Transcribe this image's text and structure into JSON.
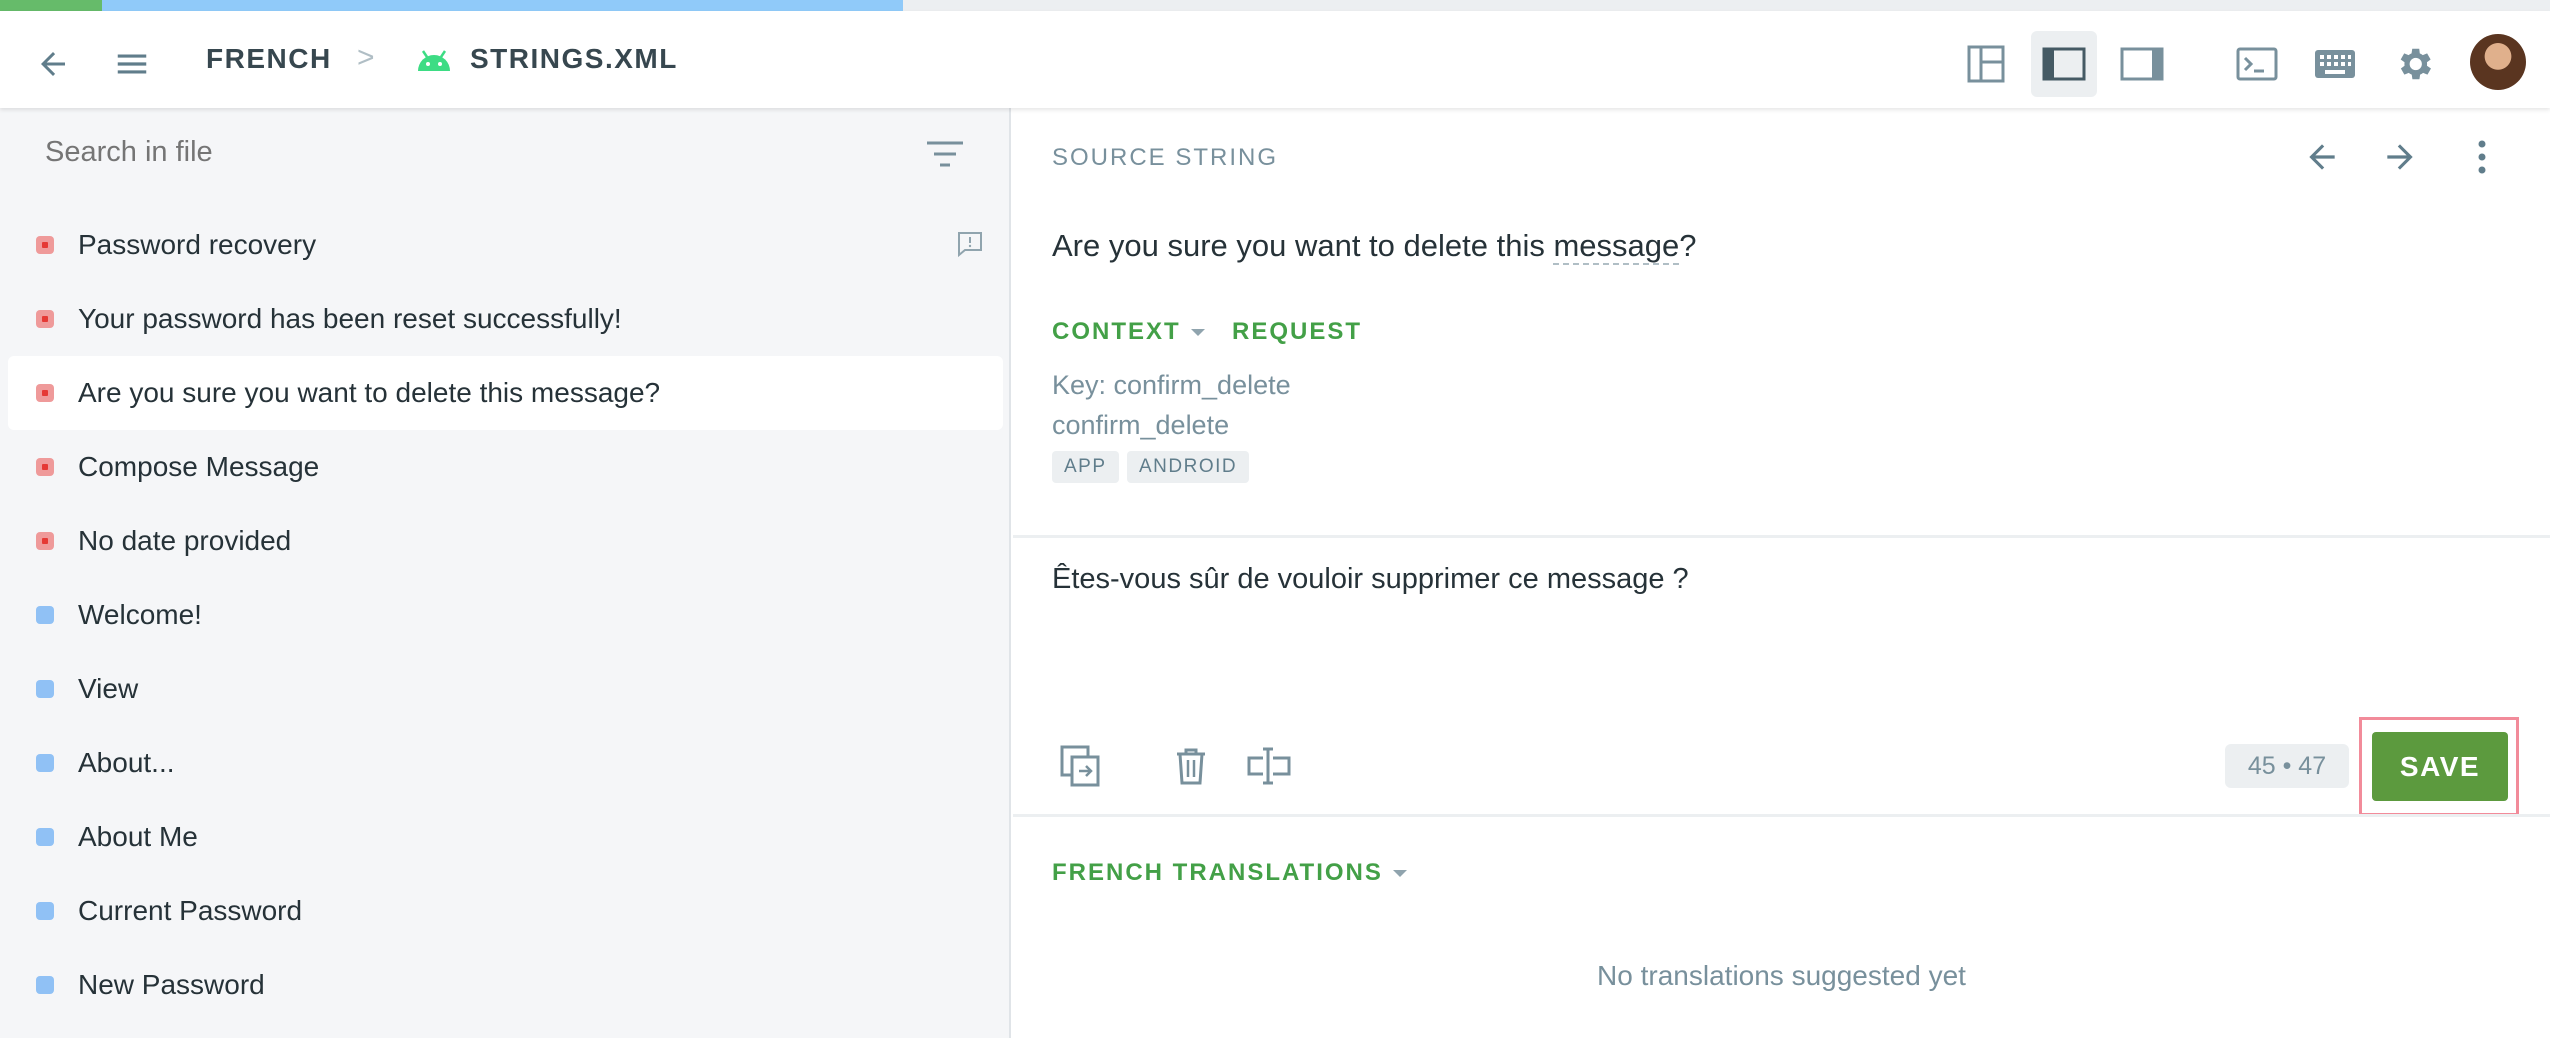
{
  "progress": {
    "approved_fraction": 0.04,
    "translated_fraction": 0.314,
    "approved_color": "#66bb6a",
    "translated_color": "#90caf9"
  },
  "header": {
    "locale": "FRENCH",
    "breadcrumb_separator": ">",
    "file_name": "STRINGS.XML",
    "icons": [
      "back-arrow-icon",
      "menu-icon",
      "android-icon",
      "layout-grid-icon",
      "layout-left-icon",
      "layout-right-icon",
      "terminal-icon",
      "keyboard-icon",
      "gear-icon",
      "avatar"
    ]
  },
  "sidebar": {
    "search_placeholder": "Search in file",
    "strings": [
      {
        "text": "Password recovery",
        "status": "missing",
        "has_comment": true
      },
      {
        "text": "Your password has been reset successfully!",
        "status": "missing"
      },
      {
        "text": "Are you sure you want to delete this message?",
        "status": "missing",
        "selected": true
      },
      {
        "text": "Compose Message",
        "status": "missing"
      },
      {
        "text": "No date provided",
        "status": "missing"
      },
      {
        "text": "Welcome!",
        "status": "translated"
      },
      {
        "text": "View",
        "status": "translated"
      },
      {
        "text": "About...",
        "status": "translated"
      },
      {
        "text": "About Me",
        "status": "translated"
      },
      {
        "text": "Current Password",
        "status": "translated"
      },
      {
        "text": "New Password",
        "status": "translated"
      }
    ],
    "status_colors": {
      "missing": "#e53935",
      "translated": "#90c1f5"
    }
  },
  "editor": {
    "source_label": "SOURCE STRING",
    "source_text_before": "Are you sure you want to delete this ",
    "source_term": "message",
    "source_text_after": "?",
    "context_tab": "CONTEXT",
    "request_tab": "REQUEST",
    "key_line": "Key: confirm_delete",
    "identifier": "confirm_delete",
    "tags": [
      "APP",
      "ANDROID"
    ],
    "translation_value": "Êtes-vous sûr de vouloir supprimer ce message ?",
    "char_count": "45 • 47",
    "save_label": "SAVE",
    "translations_label": "FRENCH TRANSLATIONS",
    "empty_translations": "No translations suggested yet",
    "accent_color": "#43a047",
    "save_color": "#5c9a3e"
  }
}
